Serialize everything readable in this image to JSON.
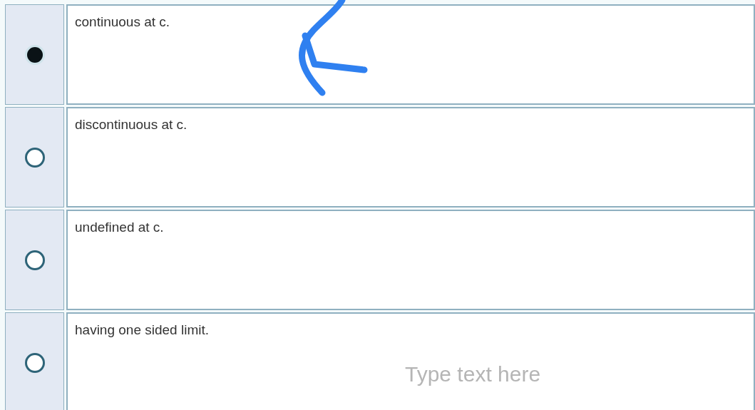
{
  "options": [
    {
      "label": "continuous at c.",
      "selected": true
    },
    {
      "label": "discontinuous at c.",
      "selected": false
    },
    {
      "label": "undefined at c.",
      "selected": false
    },
    {
      "label": "having one sided limit.",
      "selected": false
    }
  ],
  "text_overlay": {
    "placeholder": "Type text here"
  }
}
